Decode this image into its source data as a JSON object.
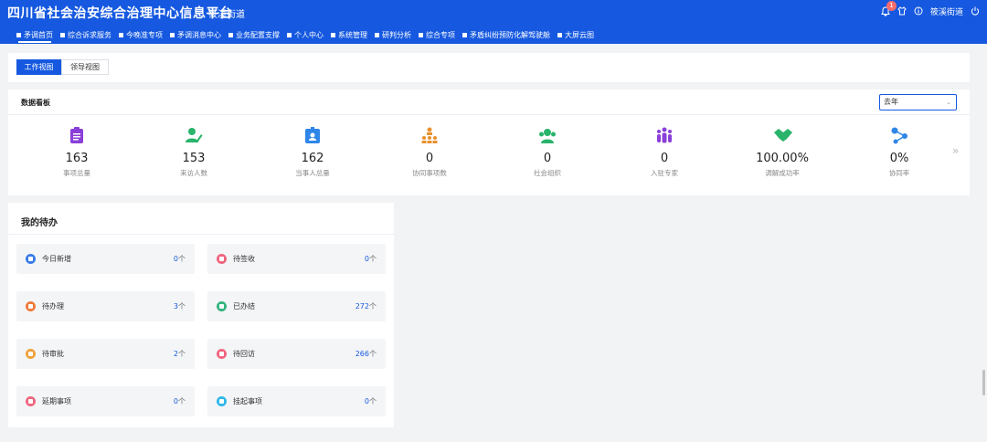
{
  "header": {
    "title": "四川省社会治安综合治理中心信息平台",
    "subtitle": "筱溪街道",
    "badge_count": "1",
    "user": "筱溪街道",
    "icons": [
      "bell-icon",
      "shirt-icon",
      "info-icon",
      "user-name",
      "power-icon"
    ]
  },
  "nav": [
    {
      "label": "矛调首页",
      "active": true
    },
    {
      "label": "综合诉求服务"
    },
    {
      "label": "今晚准专项"
    },
    {
      "label": "矛调消息中心"
    },
    {
      "label": "业务配置支撑"
    },
    {
      "label": "个人中心"
    },
    {
      "label": "系统管理"
    },
    {
      "label": "研判分析"
    },
    {
      "label": "综合专项"
    },
    {
      "label": "矛盾纠纷预防化解驾驶舱"
    },
    {
      "label": "大屏云图"
    }
  ],
  "view_tabs": [
    {
      "label": "工作视图",
      "active": true
    },
    {
      "label": "领导视图"
    }
  ],
  "dashboard": {
    "title": "数据看板",
    "period": "去年",
    "stats": [
      {
        "value": "163",
        "label": "事项总量",
        "color": "#8b3fd9",
        "icon": "clipboard-icon"
      },
      {
        "value": "153",
        "label": "来访人数",
        "color": "#29b36b",
        "icon": "person-edit-icon"
      },
      {
        "value": "162",
        "label": "当事人总量",
        "color": "#2f86e8",
        "icon": "id-card-icon"
      },
      {
        "value": "0",
        "label": "协同事项数",
        "color": "#e8912f",
        "icon": "org-chart-icon"
      },
      {
        "value": "0",
        "label": "社会组织",
        "color": "#29b36b",
        "icon": "group-icon"
      },
      {
        "value": "0",
        "label": "入驻专家",
        "color": "#8b3fd9",
        "icon": "people-icon"
      },
      {
        "value": "100.00%",
        "label": "调解成功率",
        "color": "#29b36b",
        "icon": "handshake-icon"
      },
      {
        "value": "0%",
        "label": "协同率",
        "color": "#2f86e8",
        "icon": "share-icon"
      }
    ]
  },
  "todo": {
    "title": "我的待办",
    "items": [
      {
        "label": "今日新增",
        "count": "0",
        "unit": "个",
        "color": "#3a7be8",
        "icon": "new-doc-icon"
      },
      {
        "label": "待签收",
        "count": "0",
        "unit": "个",
        "color": "#f0657e",
        "icon": "sign-icon"
      },
      {
        "label": "待办理",
        "count": "3",
        "unit": "个",
        "color": "#f07a3a",
        "icon": "handle-icon"
      },
      {
        "label": "已办结",
        "count": "272",
        "unit": "个",
        "color": "#36b37e",
        "icon": "done-icon"
      },
      {
        "label": "待审批",
        "count": "2",
        "unit": "个",
        "color": "#f0a23a",
        "icon": "approve-icon"
      },
      {
        "label": "待回访",
        "count": "266",
        "unit": "个",
        "color": "#f0657e",
        "icon": "revisit-icon"
      },
      {
        "label": "延期事项",
        "count": "0",
        "unit": "个",
        "color": "#f0657e",
        "icon": "delay-icon"
      },
      {
        "label": "挂起事项",
        "count": "0",
        "unit": "个",
        "color": "#2fb8e8",
        "icon": "suspend-icon"
      }
    ]
  }
}
